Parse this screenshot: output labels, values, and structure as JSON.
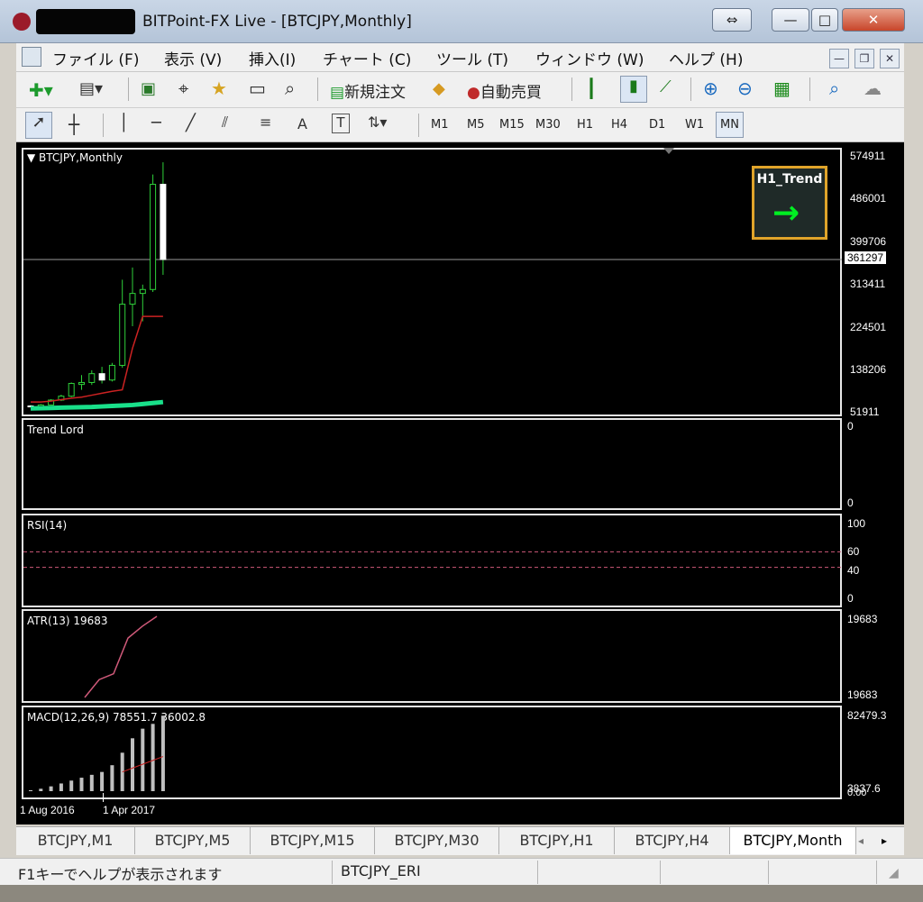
{
  "window": {
    "title": "BITPoint-FX Live - [BTCJPY,Monthly]"
  },
  "titlebar_buttons": {
    "resize": "⇔",
    "min": "—",
    "max": "□",
    "close": "✕"
  },
  "menu": [
    "ファイル (F)",
    "表示 (V)",
    "挿入(I)",
    "チャート (C)",
    "ツール (T)",
    "ウィンドウ (W)",
    "ヘルプ (H)"
  ],
  "toolbar": {
    "new_order": "新規注文",
    "auto_trade": "自動売買"
  },
  "toolbar2": {
    "text_tool": "A",
    "label_tool": "T"
  },
  "timeframes": [
    "M1",
    "M5",
    "M15",
    "M30",
    "H1",
    "H4",
    "D1",
    "W1",
    "MN"
  ],
  "main_chart": {
    "label": "BTCJPY,Monthly",
    "price_axis": [
      "574911",
      "486001",
      "399706",
      "361297",
      "313411",
      "224501",
      "138206",
      "51911"
    ],
    "current_price": "361297"
  },
  "trend_widget": {
    "title": "H1_Trend",
    "arrow": "→",
    "color": "#00ee22"
  },
  "subwindows": [
    {
      "label": "Trend Lord",
      "axis": [
        "0",
        "0"
      ]
    },
    {
      "label": "RSI(14)",
      "axis": [
        "100",
        "60",
        "40",
        "0"
      ]
    },
    {
      "label": "ATR(13) 19683",
      "axis": [
        "19683",
        "19683"
      ]
    },
    {
      "label": "MACD(12,26,9) 78551.7 36002.8",
      "axis": [
        "82479.3",
        "3837.6",
        "0.00"
      ]
    }
  ],
  "time_axis": [
    "1 Aug 2016",
    "1 Apr 2017"
  ],
  "chart_tabs": [
    "BTCJPY,M1",
    "BTCJPY,M5",
    "BTCJPY,M15",
    "BTCJPY,M30",
    "BTCJPY,H1",
    "BTCJPY,H4",
    "BTCJPY,Month"
  ],
  "status": {
    "help": "F1キーでヘルプが表示されます",
    "profile": "BTCJPY_ERI"
  },
  "colors": {
    "bull": "#2fd13a",
    "ma_red": "#cc2222",
    "ma_green": "#19e08a",
    "rsi_level": "#d05a7a",
    "atr_line": "#d05a7a",
    "macd_hist": "#c0c0c0",
    "macd_signal": "#cc2222"
  },
  "chart_data": {
    "type": "line",
    "candles": [
      {
        "x": "2016-08",
        "o": 62000,
        "h": 64000,
        "l": 59000,
        "c": 61000
      },
      {
        "x": "2016-09",
        "o": 61000,
        "h": 66000,
        "l": 60000,
        "c": 64000
      },
      {
        "x": "2016-10",
        "o": 64000,
        "h": 76000,
        "l": 63000,
        "c": 74000
      },
      {
        "x": "2016-11",
        "o": 74000,
        "h": 85000,
        "l": 72000,
        "c": 82000
      },
      {
        "x": "2016-12",
        "o": 82000,
        "h": 110000,
        "l": 80000,
        "c": 108000
      },
      {
        "x": "2017-01",
        "o": 106000,
        "h": 125000,
        "l": 95000,
        "c": 110000
      },
      {
        "x": "2017-02",
        "o": 110000,
        "h": 135000,
        "l": 105000,
        "c": 128000
      },
      {
        "x": "2017-03",
        "o": 128000,
        "h": 142000,
        "l": 108000,
        "c": 115000
      },
      {
        "x": "2017-04",
        "o": 115000,
        "h": 150000,
        "l": 112000,
        "c": 145000
      },
      {
        "x": "2017-05",
        "o": 145000,
        "h": 320000,
        "l": 140000,
        "c": 270000
      },
      {
        "x": "2017-06",
        "o": 270000,
        "h": 345000,
        "l": 225000,
        "c": 292000
      },
      {
        "x": "2017-07",
        "o": 292000,
        "h": 310000,
        "l": 235000,
        "c": 300000
      },
      {
        "x": "2017-08",
        "o": 300000,
        "h": 535000,
        "l": 295000,
        "c": 515000
      },
      {
        "x": "2017-09",
        "o": 515000,
        "h": 560000,
        "l": 330000,
        "c": 361297
      }
    ],
    "series": [
      {
        "values": [
          70000,
          70000,
          72000,
          75000,
          78000,
          80000,
          84000,
          88000,
          92000,
          95000,
          180000,
          245000,
          245000,
          245000
        ]
      },
      {
        "values": [
          57000,
          57500,
          58000,
          58500,
          59000,
          59500,
          60000,
          61000,
          62000,
          63000,
          64000,
          66000,
          68000,
          70000
        ]
      }
    ],
    "atr": [
      19000,
      19150,
      19200,
      19500,
      19600,
      19683
    ],
    "macd_hist": [
      1000,
      2500,
      5000,
      8000,
      11000,
      14000,
      17000,
      20000,
      27000,
      40000,
      55000,
      65000,
      70000,
      78551.7
    ],
    "macd_signal": [
      20000,
      24000,
      28000,
      32000,
      36002.8
    ],
    "ylim": [
      51911,
      574911
    ],
    "rsi_levels": [
      60,
      40
    ]
  }
}
